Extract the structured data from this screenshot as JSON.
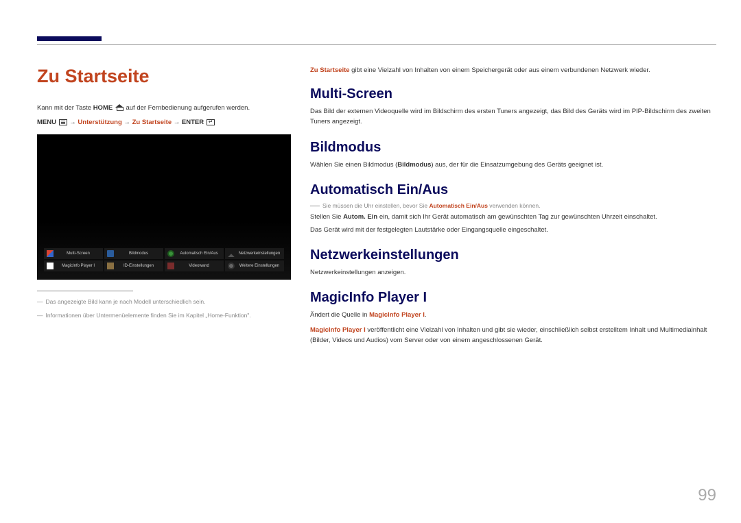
{
  "page": {
    "title": "Zu Startseite",
    "number": "99"
  },
  "left": {
    "intro_pre": "Kann mit der Taste ",
    "intro_home": "HOME",
    "intro_post": " auf der Fernbedienung aufgerufen werden.",
    "nav_menu": "MENU",
    "nav_arrow1": " → ",
    "nav_support": "Unterstützung",
    "nav_arrow2": " → ",
    "nav_home": "Zu Startseite",
    "nav_arrow3": " → ",
    "nav_enter": "ENTER",
    "footnote1": "Das angezeigte Bild kann je nach Modell unterschiedlich sein.",
    "footnote2": "Informationen über Untermenüelemente finden Sie im Kapitel „Home-Funktion\"."
  },
  "tv_tiles": [
    {
      "label": "Multi-Screen"
    },
    {
      "label": "Bildmodus"
    },
    {
      "label": "Automatisch Ein/Aus"
    },
    {
      "label": "Netzwerkeinstellungen"
    },
    {
      "label": "MagicInfo Player I"
    },
    {
      "label": "ID-Einstellungen"
    },
    {
      "label": "Videowand"
    },
    {
      "label": "Weitere Einstellungen"
    }
  ],
  "right": {
    "intro_em": "Zu Startseite",
    "intro_text": " gibt eine Vielzahl von Inhalten von einem Speichergerät oder aus einem verbundenen Netzwerk wieder.",
    "sections": {
      "multi": {
        "title": "Multi-Screen",
        "body": "Das Bild der externen Videoquelle wird im Bildschirm des ersten Tuners angezeigt, das Bild des Geräts wird im PIP-Bildschirm des zweiten Tuners angezeigt."
      },
      "bild": {
        "title": "Bildmodus",
        "body_pre": "Wählen Sie einen Bildmodus (",
        "body_em": "Bildmodus",
        "body_post": ") aus, der für die Einsatzumgebung des Geräts geeignet ist."
      },
      "auto": {
        "title": "Automatisch Ein/Aus",
        "note_pre": "Sie müssen die Uhr einstellen, bevor Sie ",
        "note_em": "Automatisch Ein/Aus",
        "note_post": " verwenden können.",
        "line2_pre": "Stellen Sie ",
        "line2_em": "Autom. Ein",
        "line2_post": " ein, damit sich Ihr Gerät automatisch am gewünschten Tag zur gewünschten Uhrzeit einschaltet.",
        "line3": "Das Gerät wird mit der festgelegten Lautstärke oder Eingangsquelle eingeschaltet."
      },
      "net": {
        "title": "Netzwerkeinstellungen",
        "body": "Netzwerkeinstellungen anzeigen."
      },
      "magic": {
        "title": "MagicInfo Player I",
        "line1_pre": "Ändert die Quelle in ",
        "line1_em": "MagicInfo Player I",
        "line1_post": ".",
        "line2_em": "MagicInfo Player I",
        "line2_body": " veröffentlicht eine Vielzahl von Inhalten und gibt sie wieder, einschließlich selbst erstelltem Inhalt und Multimediainhalt (Bilder, Videos und Audios) vom Server oder von einem angeschlossenen Gerät."
      }
    }
  }
}
